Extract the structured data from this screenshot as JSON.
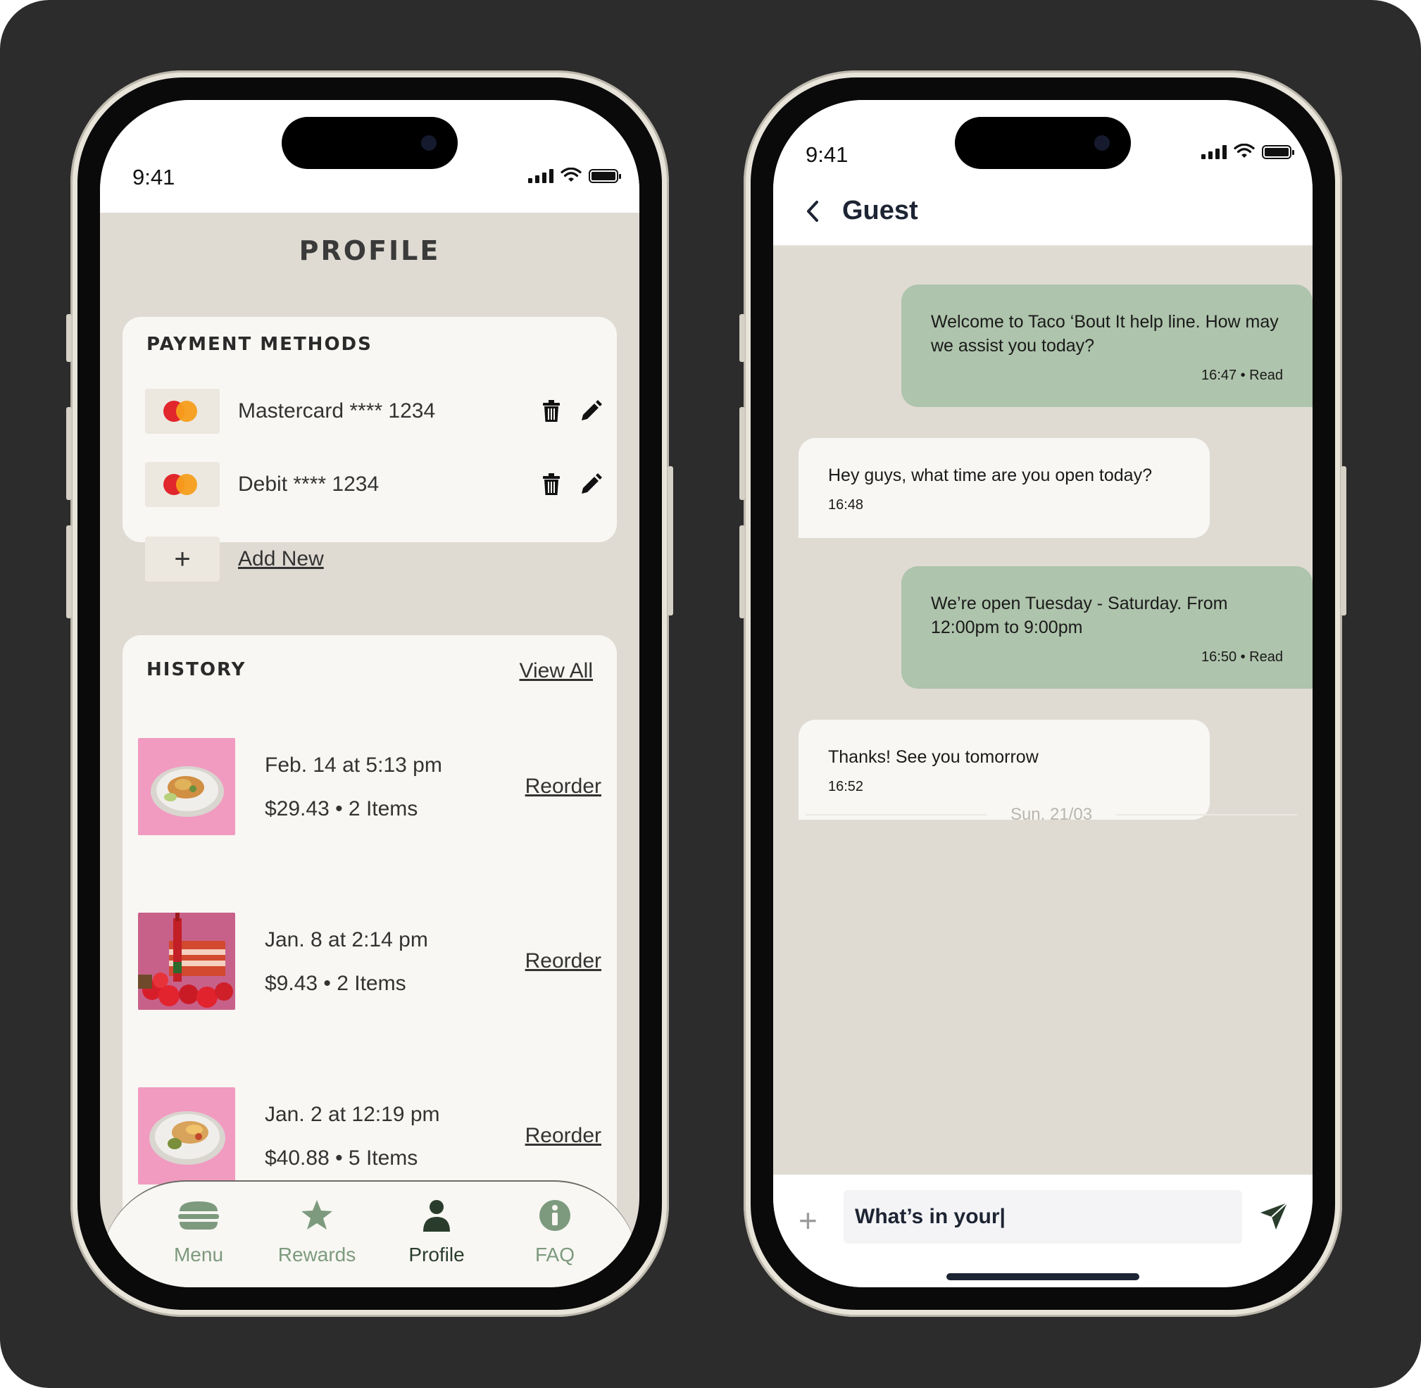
{
  "status_bar": {
    "time": "9:41"
  },
  "profile": {
    "title": "PROFILE",
    "payment": {
      "heading": "PAYMENT METHODS",
      "cards": [
        {
          "label": "Mastercard **** 1234"
        },
        {
          "label": "Debit **** 1234"
        }
      ],
      "add_plus": "+",
      "add_label": "Add New"
    },
    "history": {
      "heading": "HISTORY",
      "view_all": "View All",
      "items": [
        {
          "date": "Feb. 14 at 5:13 pm",
          "meta": "$29.43 • 2 Items",
          "action": "Reorder"
        },
        {
          "date": "Jan. 8 at 2:14 pm",
          "meta": "$9.43 • 2 Items",
          "action": "Reorder"
        },
        {
          "date": "Jan. 2 at 12:19 pm",
          "meta": "$40.88 • 5 Items",
          "action": "Reorder"
        }
      ]
    },
    "tabs": [
      {
        "label": "Menu",
        "icon": "burger-icon",
        "active": false
      },
      {
        "label": "Rewards",
        "icon": "star-icon",
        "active": false
      },
      {
        "label": "Profile",
        "icon": "person-icon",
        "active": true
      },
      {
        "label": "FAQ",
        "icon": "info-icon",
        "active": false
      }
    ]
  },
  "chat": {
    "title": "Guest",
    "messages": [
      {
        "dir": "out",
        "text": "Welcome to Taco ‘Bout It help line. How may we assist you today?",
        "time": "16:47 • Read"
      },
      {
        "dir": "in",
        "text": "Hey guys, what time are you open today?",
        "time": "16:48"
      },
      {
        "dir": "out",
        "text": "We’re open Tuesday - Saturday. From 12:00pm to 9:00pm",
        "time": "16:50 • Read"
      },
      {
        "dir": "in",
        "text": "Thanks! See you tomorrow",
        "time": "16:52"
      }
    ],
    "date_divider": "Sun. 21/03",
    "composer": {
      "plus": "+",
      "value": "What’s in your|"
    }
  },
  "colors": {
    "background": "#2c2c2c",
    "screen_bg": "#dfdbd3",
    "card_bg": "#f8f7f3",
    "outgoing_bubble": "#aec4ac",
    "tab_active": "#2a3d2c",
    "tab_inactive": "#7d9a7e"
  }
}
